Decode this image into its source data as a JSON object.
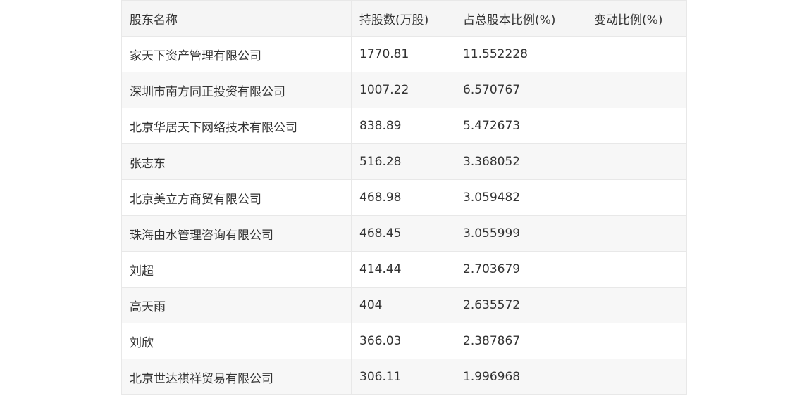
{
  "table": {
    "headers": {
      "name": "股东名称",
      "shares": "持股数(万股)",
      "ratio": "占总股本比例(%)",
      "change": "变动比例(%)"
    },
    "rows": [
      {
        "name": "家天下资产管理有限公司",
        "shares": "1770.81",
        "ratio": "11.552228",
        "change": ""
      },
      {
        "name": "深圳市南方同正投资有限公司",
        "shares": "1007.22",
        "ratio": "6.570767",
        "change": ""
      },
      {
        "name": "北京华居天下网络技术有限公司",
        "shares": "838.89",
        "ratio": "5.472673",
        "change": ""
      },
      {
        "name": "张志东",
        "shares": "516.28",
        "ratio": "3.368052",
        "change": ""
      },
      {
        "name": "北京美立方商贸有限公司",
        "shares": "468.98",
        "ratio": "3.059482",
        "change": ""
      },
      {
        "name": "珠海由水管理咨询有限公司",
        "shares": "468.45",
        "ratio": "3.055999",
        "change": ""
      },
      {
        "name": "刘超",
        "shares": "414.44",
        "ratio": "2.703679",
        "change": ""
      },
      {
        "name": "高天雨",
        "shares": "404",
        "ratio": "2.635572",
        "change": ""
      },
      {
        "name": "刘欣",
        "shares": "366.03",
        "ratio": "2.387867",
        "change": ""
      },
      {
        "name": "北京世达祺祥贸易有限公司",
        "shares": "306.11",
        "ratio": "1.996968",
        "change": ""
      }
    ]
  },
  "colors": {
    "header_bg": "#f5f5f5",
    "stripe_bg": "#f7f7f7",
    "border": "#e8e8e8",
    "text": "#333333"
  }
}
